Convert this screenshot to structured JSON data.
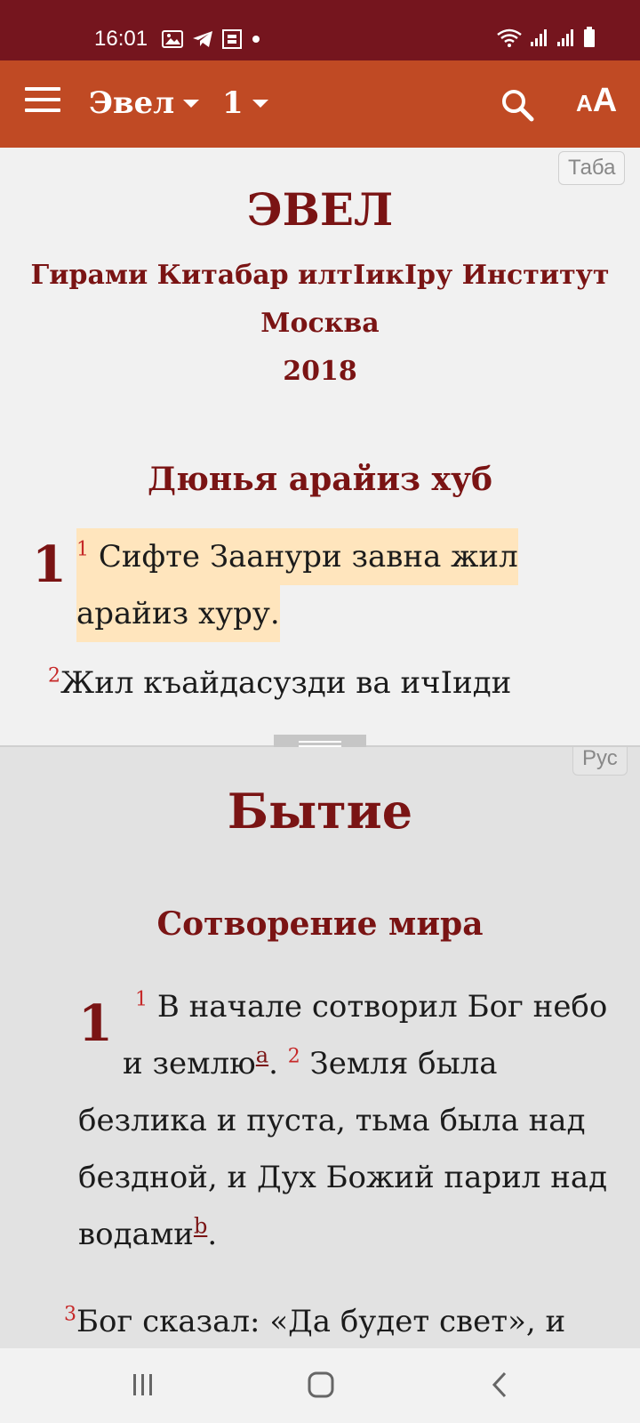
{
  "status": {
    "time": "16:01",
    "left_icons": [
      "image-icon",
      "telegram-icon",
      "stack-icon",
      "dot-icon"
    ],
    "right_icons": [
      "wifi-icon",
      "signal-icon",
      "signal-icon",
      "battery-icon"
    ]
  },
  "toolbar": {
    "book": "Эвел",
    "chapter": "1",
    "font_btn_small": "A",
    "font_btn_big": "A"
  },
  "pane1": {
    "lang": "Таба",
    "title": "ЭВЕЛ",
    "publisher": "Гирами Китабар илтIикIру Институт",
    "city": "Москва",
    "year": "2018",
    "heading": "Дюнья арайиз хуб",
    "chapter": "1",
    "v1_num": "1",
    "v1_line1": "Сифте Заанури завна жил",
    "v1_line2": "арайиз хуру.",
    "v2_num": "2",
    "v2_line1": "Жил къайдасузди ва ичIиди"
  },
  "pane2": {
    "lang": "Рус",
    "title": "Бытие",
    "heading": "Сотворение мира",
    "chapter": "1",
    "v1_num": "1",
    "l1": "В начале сотворил Бог небо",
    "l2a": "и землю",
    "fn_a": "a",
    "l2b": ".",
    "v2_num": "2",
    "l2c": "Земля была",
    "l3": "безлика и пуста, тьма была над",
    "l4": "бездной, и Дух Божий парил над",
    "l5a": "водами",
    "fn_b": "b",
    "l5b": ".",
    "v3_num": "3",
    "l6": "Бог сказал: «Да будет свет», и"
  }
}
